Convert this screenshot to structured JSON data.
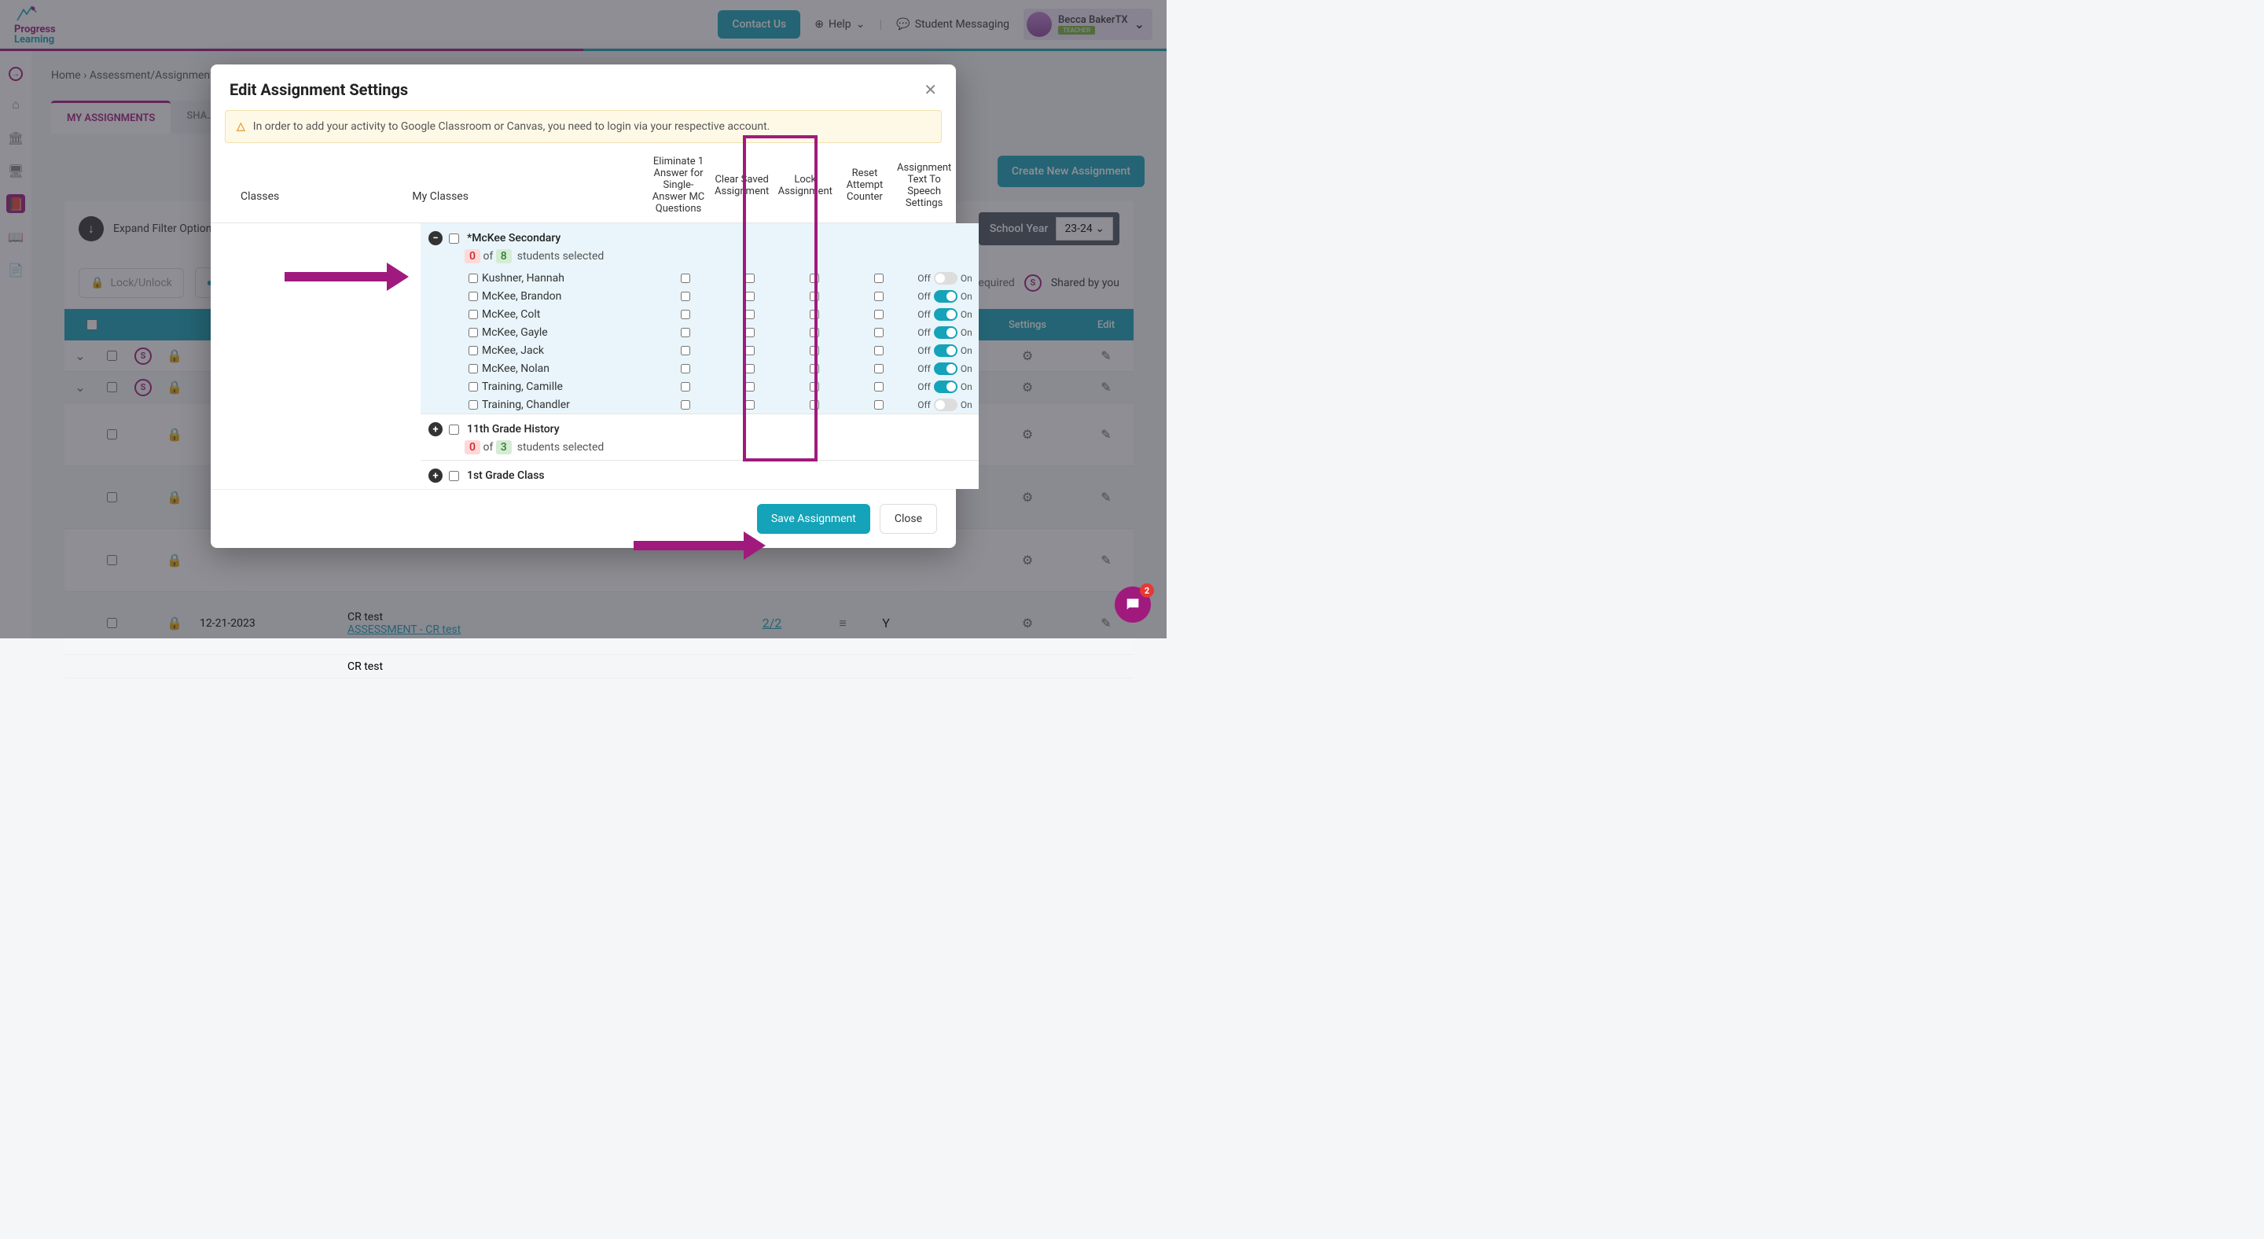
{
  "header": {
    "logo_line1": "Progress",
    "logo_line2": "Learning",
    "contact": "Contact Us",
    "help": "Help",
    "messaging": "Student Messaging",
    "user_name": "Becca BakerTX",
    "user_role": "TEACHER"
  },
  "breadcrumb": {
    "home": "Home",
    "section": "Assessment/Assignment…"
  },
  "tabs": {
    "my": "MY ASSIGNMENTS",
    "shared": "SHA…"
  },
  "buttons": {
    "create": "Create New Assignment",
    "expand": "Expand Filter Options",
    "lockunlock": "Lock/Unlock"
  },
  "school_year": {
    "label": "School Year",
    "value": "23-24"
  },
  "legend": {
    "grading": "…ading Required",
    "shared": "Shared by you"
  },
  "table_headers": {
    "settings": "Settings",
    "edit": "Edit"
  },
  "rows": [
    {
      "date": "12-21-2023",
      "name_top": "CR test",
      "name_link": "ASSESSMENT - CR test",
      "frac": "2/2",
      "y": "Y"
    },
    {
      "date": "",
      "name_top": "CR test",
      "name_link": "",
      "frac": "",
      "y": ""
    }
  ],
  "modal": {
    "title": "Edit Assignment Settings",
    "warning": "In order to add your activity to Google Classroom or Canvas, you need to login via your respective account.",
    "classes_label": "Classes",
    "my_classes_label": "My Classes",
    "columns": {
      "c1": "Eliminate 1 Answer for Single-Answer MC Questions",
      "c2": "Clear Saved Assignment",
      "c3": "Lock Assignment",
      "c4": "Reset Attempt Counter",
      "c5": "Assignment Text To Speech Settings"
    },
    "classes": [
      {
        "name": "*McKee Secondary",
        "expanded": true,
        "selected": 0,
        "total": 8,
        "students": [
          {
            "name": "Kushner, Hannah",
            "tts": "off"
          },
          {
            "name": "McKee, Brandon",
            "tts": "on"
          },
          {
            "name": "McKee, Colt",
            "tts": "on"
          },
          {
            "name": "McKee, Gayle",
            "tts": "on"
          },
          {
            "name": "McKee, Jack",
            "tts": "on"
          },
          {
            "name": "McKee, Nolan",
            "tts": "on"
          },
          {
            "name": "Training, Camille",
            "tts": "on"
          },
          {
            "name": "Training, Chandler",
            "tts": "off"
          }
        ]
      },
      {
        "name": "11th Grade History",
        "expanded": false,
        "selected": 0,
        "total": 3
      },
      {
        "name": "1st Grade Class",
        "expanded": false
      }
    ],
    "students_selected_label": "students selected",
    "of_label": "of",
    "off_label": "Off",
    "on_label": "On",
    "save": "Save Assignment",
    "close": "Close"
  },
  "chat_badge": "2"
}
